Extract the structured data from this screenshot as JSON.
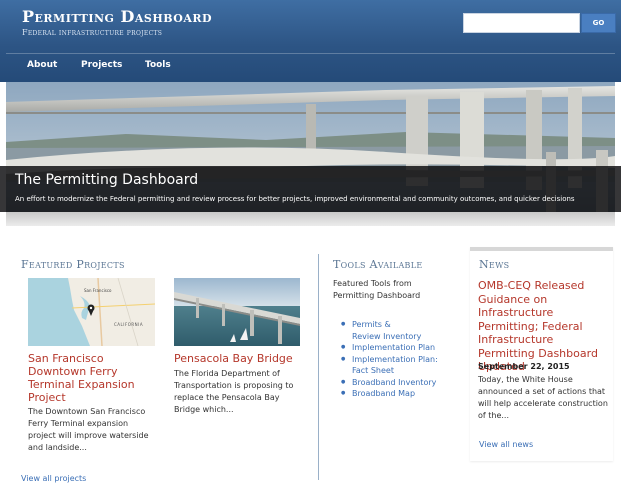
{
  "header": {
    "title": "Permitting Dashboard",
    "subtitle": "Federal infrastructure projects",
    "search": {
      "value": "",
      "placeholder": ""
    },
    "go_label": "GO"
  },
  "nav": {
    "items": [
      {
        "label": "About"
      },
      {
        "label": "Projects"
      },
      {
        "label": "Tools"
      }
    ]
  },
  "hero": {
    "title": "The Permitting Dashboard",
    "text": "An effort to modernize the Federal permitting and review process for better projects, improved environmental and community outcomes, and quicker decisions"
  },
  "featured": {
    "heading": "Featured Projects",
    "projects": [
      {
        "title": "San Francisco Downtown Ferry Terminal Expansion Project",
        "description": "The Downtown San Francisco Ferry Terminal expansion project will improve waterside and landside...",
        "map_labels": {
          "city": "San Francisco",
          "state": "CALIFORNIA"
        }
      },
      {
        "title": "Pensacola Bay Bridge",
        "description": "The Florida Department of Transportation is proposing to replace the Pensacola Bay Bridge which..."
      }
    ],
    "view_all": "View all projects"
  },
  "tools": {
    "heading": "Tools Available",
    "intro": "Featured Tools from Permitting Dashboard",
    "items": [
      {
        "label": "Permits &",
        "label2": "Review Inventory"
      },
      {
        "label": "Implementation Plan"
      },
      {
        "label": "Implementation Plan:",
        "label2": "Fact Sheet"
      },
      {
        "label": "Broadband Inventory"
      },
      {
        "label": "Broadband Map"
      }
    ]
  },
  "news": {
    "heading": "News",
    "title": "OMB-CEQ Released Guidance on Infrastructure Permitting; Federal Infrastructure Permitting Dashboard Updated",
    "date": "September 22, 2015",
    "text": "Today, the White House announced a set of actions that will help accelerate construction of the...",
    "view_all": "View all news"
  },
  "colors": {
    "header_blue": "#2d5585",
    "link_red": "#b5372b",
    "link_blue": "#3b6fb6",
    "heading_slate": "#5b7694"
  }
}
